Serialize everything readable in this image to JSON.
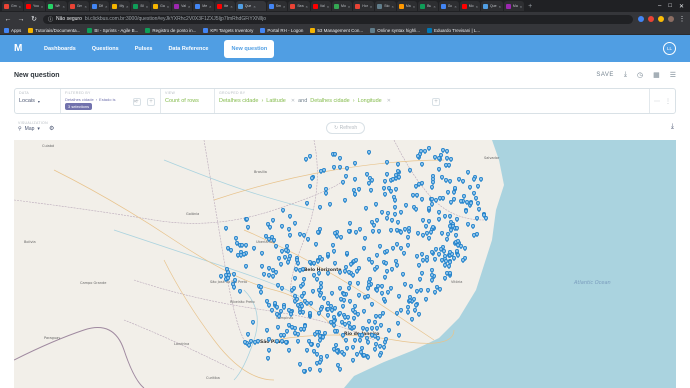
{
  "browser": {
    "tabs": [
      {
        "title": "Gm",
        "color": "#ea4335"
      },
      {
        "title": "You",
        "color": "#ff0000"
      },
      {
        "title": "Wh",
        "color": "#25d366"
      },
      {
        "title": "Gm",
        "color": "#ea4335"
      },
      {
        "title": "Dif",
        "color": "#4285f4"
      },
      {
        "title": "My",
        "color": "#f4b400"
      },
      {
        "title": "BI",
        "color": "#0f9d58"
      },
      {
        "title": "Ga",
        "color": "#f4b400"
      },
      {
        "title": "Val",
        "color": "#9c27b0"
      },
      {
        "title": "Me",
        "color": "#4285f4"
      },
      {
        "title": "Me",
        "color": "#ff0000"
      },
      {
        "title": "Que",
        "color": "#509ee3",
        "active": true
      },
      {
        "title": "Sm",
        "color": "#4285f4"
      },
      {
        "title": "Sea",
        "color": "#ea4335"
      },
      {
        "title": "Val",
        "color": "#ff0000"
      },
      {
        "title": "Mo",
        "color": "#34a853"
      },
      {
        "title": "Hor",
        "color": "#ea4335"
      },
      {
        "title": "Sto",
        "color": "#607d8b"
      },
      {
        "title": "Ma",
        "color": "#ff9800"
      },
      {
        "title": "Bu",
        "color": "#0f9d58"
      },
      {
        "title": "Go",
        "color": "#4285f4"
      },
      {
        "title": "Mo",
        "color": "#ff0000"
      },
      {
        "title": "Que",
        "color": "#509ee3"
      },
      {
        "title": "Ma",
        "color": "#9c27b0"
      }
    ],
    "insecure_label": "Não seguro",
    "url": "bi.clickbus.com.br:3000/question#eyJkYXRhc2V0X3F1ZXJ5Ijp7ImRhdGFiYXNlIjo",
    "bookmarks": [
      {
        "label": "Apps",
        "color": "#4285f4"
      },
      {
        "label": "Tutoriais/Documenta...",
        "color": "#f4b400"
      },
      {
        "label": "BI - Sprints - Agile B...",
        "color": "#0f9d58"
      },
      {
        "label": "Registro de ponto in...",
        "color": "#0f9d58"
      },
      {
        "label": "KPI Targets Inventory",
        "color": "#4285f4"
      },
      {
        "label": "Portal RH - Logon",
        "color": "#4285f4"
      },
      {
        "label": "53 Management Con...",
        "color": "#f4b400"
      },
      {
        "label": "Online syntax highli...",
        "color": "#607d8b"
      },
      {
        "label": "Eduardo Trevisani | L...",
        "color": "#0077b5"
      }
    ]
  },
  "nav": {
    "logo": "M",
    "links": [
      "Dashboards",
      "Questions",
      "Pulses",
      "Data Reference"
    ],
    "new_question": "New question",
    "avatar": "LL"
  },
  "header": {
    "title": "New question",
    "save": "SAVE"
  },
  "query": {
    "data_label": "DATA",
    "data_value": "Locais",
    "filter_label": "FILTERED BY",
    "filter_field": "Detalhes cidade",
    "filter_field2": "Estado is",
    "filter_value": "3 selections",
    "view_label": "VIEW",
    "view_value": "Count of rows",
    "group_label": "GROUPED BY",
    "group_1a": "Detalhes cidade",
    "group_1b": "Latitude",
    "group_and": "and",
    "group_2a": "Detalhes cidade",
    "group_2b": "Longitude"
  },
  "viz": {
    "label": "VISUALIZATION",
    "type": "Map",
    "refresh": "Refresh"
  },
  "map": {
    "pin_color": "#2f8fd6",
    "cities": [
      {
        "name": "Cuiabá"
      },
      {
        "name": "Goiânia"
      },
      {
        "name": "Brasília"
      },
      {
        "name": "Campo Grande"
      },
      {
        "name": "Belo Horizonte"
      },
      {
        "name": "São Paulo"
      },
      {
        "name": "Rio de Janeiro"
      },
      {
        "name": "Vitória"
      },
      {
        "name": "Salvador"
      },
      {
        "name": "Curitiba"
      },
      {
        "name": "Ribeirão Preto"
      },
      {
        "name": "São José do Rio Preto"
      },
      {
        "name": "Uberlândia"
      },
      {
        "name": "Londrina"
      },
      {
        "name": "Campinas"
      }
    ],
    "country_labels": [
      {
        "name": "Paraguay"
      },
      {
        "name": "Bolivia"
      }
    ],
    "ocean_label": "Atlantic Ocean"
  }
}
